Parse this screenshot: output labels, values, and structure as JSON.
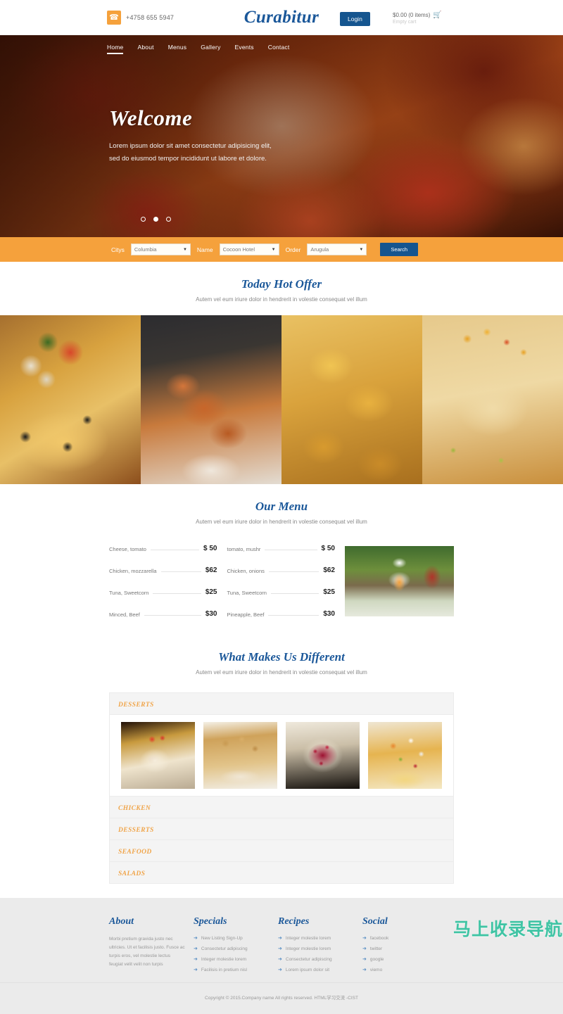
{
  "topbar": {
    "phone": "+4758 655 5947",
    "phone_icon": "phone-icon",
    "brand": "Curabitur",
    "login_label": "Login",
    "cart_total": "$0.00 (0 items)",
    "cart_icon": "shopping-cart-icon",
    "cart_empty": "Empty cart"
  },
  "nav": {
    "items": [
      {
        "label": "Home",
        "active": true
      },
      {
        "label": "About",
        "active": false
      },
      {
        "label": "Menus",
        "active": false
      },
      {
        "label": "Gallery",
        "active": false
      },
      {
        "label": "Events",
        "active": false
      },
      {
        "label": "Contact",
        "active": false
      }
    ]
  },
  "hero": {
    "title": "Welcome",
    "line1": "Lorem ipsum dolor sit amet consectetur adipisicing elit,",
    "line2": "sed do eiusmod tempor incididunt ut labore et dolore.",
    "dots": [
      {
        "active": false
      },
      {
        "active": true
      },
      {
        "active": false
      }
    ]
  },
  "search": {
    "fields": [
      {
        "label": "Citys",
        "value": "Columbia"
      },
      {
        "label": "Name",
        "value": "Cocoon Hotel"
      },
      {
        "label": "Order",
        "value": "Arugula"
      }
    ],
    "button_label": "Search"
  },
  "hot_offer": {
    "title": "Today Hot Offer",
    "subtitle": "Autem vel eum iriure dolor in hendrerit in volestie consequat vel illum",
    "images": [
      {
        "name": "pizza-photo"
      },
      {
        "name": "fried-chicken-photo"
      },
      {
        "name": "chicken-wings-photo"
      },
      {
        "name": "pastry-peppers-photo"
      }
    ]
  },
  "menu": {
    "title": "Our Menu",
    "subtitle": "Autem vel eum iriure dolor in hendrerit in volestie consequat vel illum",
    "left_items": [
      {
        "name": "Cheese, tomato",
        "price": "$ 50"
      },
      {
        "name": "Chicken, mozzarella",
        "price": "$62"
      },
      {
        "name": "Tuna, Sweetcorn",
        "price": "$25"
      },
      {
        "name": "Minced, Beef",
        "price": "$30"
      }
    ],
    "right_items": [
      {
        "name": "tomato, mushr",
        "price": "$ 50"
      },
      {
        "name": "Chicken, onions",
        "price": "$62"
      },
      {
        "name": "Tuna, Sweetcorn",
        "price": "$25"
      },
      {
        "name": "Pineapple, Beef",
        "price": "$30"
      }
    ],
    "chef_image": "chef-photo"
  },
  "different": {
    "title": "What Makes Us Different",
    "subtitle": "Autem vel eum iriure dolor in hendrerit in volestie consequat vel illum",
    "open_panel": "DESSERTS",
    "gallery": [
      {
        "name": "cake-roll-photo"
      },
      {
        "name": "nut-cake-photo"
      },
      {
        "name": "berry-tart-photo"
      },
      {
        "name": "fruit-platter-photo"
      }
    ],
    "closed_panels": [
      "CHICKEN",
      "DESSERTS",
      "SEAFOOD",
      "SALADS"
    ]
  },
  "footer": {
    "about": {
      "title": "About",
      "text": "Morbi pretium gravida justo nec ultricies. Ut et facilisis justo. Fusce ac turpis eros, vel molestie lectus feugiat velit velit non turpis"
    },
    "specials": {
      "title": "Specials",
      "links": [
        "New Listing Sign-Up",
        "Consectetur adipiscing",
        "Integer molestie lorem",
        "Facilisis in pretium nisl"
      ]
    },
    "recipes": {
      "title": "Recipes",
      "links": [
        "Integer molestie lorem",
        "Integer molestie lorem",
        "Consectetur adipiscing",
        "Lorem ipsum dolor sit"
      ]
    },
    "social": {
      "title": "Social",
      "links": [
        "facebook",
        "twitter",
        "google",
        "viemo"
      ]
    },
    "copyright": "Copyright © 2015.Company name All rights reserved. HTML学习交流 -CIST"
  },
  "watermark": "马上收录导航",
  "colors": {
    "brand_blue": "#1a5799",
    "accent_orange": "#f5a13c",
    "button_blue": "#15558f",
    "footer_bg": "#ebebeb",
    "watermark_green": "#3fc4a4"
  }
}
